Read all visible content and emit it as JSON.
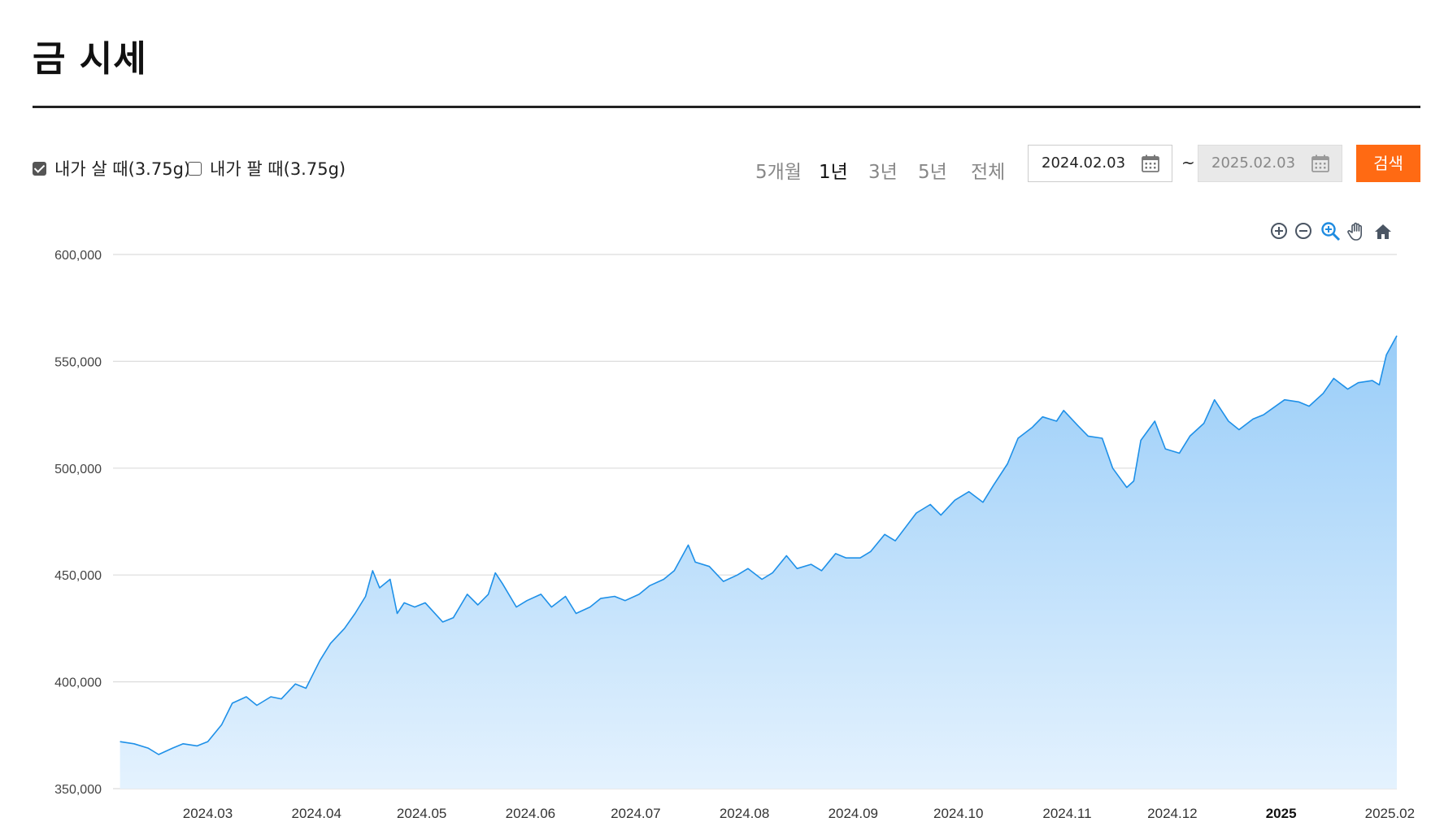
{
  "header": {
    "title": "금 시세"
  },
  "filters": {
    "buy": {
      "label": "내가 살 때(3.75g)",
      "checked": true
    },
    "sell": {
      "label": "내가 팔 때(3.75g)",
      "checked": false
    }
  },
  "periods": [
    "5개월",
    "1년",
    "3년",
    "5년",
    "전체"
  ],
  "active_period": "1년",
  "date_range": {
    "start": "2024.02.03",
    "end": "2025.02.03",
    "separator": "~"
  },
  "search_label": "검색",
  "toolbar": [
    "zoom-in-icon",
    "zoom-out-icon",
    "zoom-select-icon",
    "pan-hand-icon",
    "home-reset-icon"
  ],
  "colors": {
    "accent": "#ff6a13",
    "line": "#1e90e8",
    "area_top": "#9fd0f8",
    "area_bottom": "#e3f1fd"
  },
  "chart_data": {
    "type": "area",
    "ylim": [
      350000,
      600000
    ],
    "yticks": [
      "600,000",
      "550,000",
      "500,000",
      "450,000",
      "400,000",
      "350,000"
    ],
    "ytick_values": [
      600000,
      550000,
      500000,
      450000,
      400000,
      350000
    ],
    "xticks": [
      {
        "label": "2024.03",
        "date": "2024-03-01"
      },
      {
        "label": "2024.04",
        "date": "2024-04-01"
      },
      {
        "label": "2024.05",
        "date": "2024-05-01"
      },
      {
        "label": "2024.06",
        "date": "2024-06-01"
      },
      {
        "label": "2024.07",
        "date": "2024-07-01"
      },
      {
        "label": "2024.08",
        "date": "2024-08-01"
      },
      {
        "label": "2024.09",
        "date": "2024-09-01"
      },
      {
        "label": "2024.10",
        "date": "2024-10-01"
      },
      {
        "label": "2024.11",
        "date": "2024-11-01"
      },
      {
        "label": "2024.12",
        "date": "2024-12-01"
      },
      {
        "label": "2025",
        "date": "2025-01-01",
        "bold": true
      },
      {
        "label": "2025.02",
        "date": "2025-02-01"
      }
    ],
    "x": [
      "2024-02-05",
      "2024-02-09",
      "2024-02-13",
      "2024-02-16",
      "2024-02-20",
      "2024-02-23",
      "2024-02-27",
      "2024-03-01",
      "2024-03-05",
      "2024-03-08",
      "2024-03-12",
      "2024-03-15",
      "2024-03-19",
      "2024-03-22",
      "2024-03-26",
      "2024-03-29",
      "2024-04-02",
      "2024-04-05",
      "2024-04-09",
      "2024-04-12",
      "2024-04-15",
      "2024-04-17",
      "2024-04-19",
      "2024-04-22",
      "2024-04-24",
      "2024-04-26",
      "2024-04-29",
      "2024-05-02",
      "2024-05-07",
      "2024-05-10",
      "2024-05-14",
      "2024-05-17",
      "2024-05-20",
      "2024-05-22",
      "2024-05-24",
      "2024-05-28",
      "2024-05-31",
      "2024-06-04",
      "2024-06-07",
      "2024-06-11",
      "2024-06-14",
      "2024-06-18",
      "2024-06-21",
      "2024-06-25",
      "2024-06-28",
      "2024-07-02",
      "2024-07-05",
      "2024-07-09",
      "2024-07-12",
      "2024-07-16",
      "2024-07-18",
      "2024-07-22",
      "2024-07-26",
      "2024-07-30",
      "2024-08-02",
      "2024-08-06",
      "2024-08-09",
      "2024-08-13",
      "2024-08-16",
      "2024-08-20",
      "2024-08-23",
      "2024-08-27",
      "2024-08-30",
      "2024-09-03",
      "2024-09-06",
      "2024-09-10",
      "2024-09-13",
      "2024-09-19",
      "2024-09-23",
      "2024-09-26",
      "2024-09-30",
      "2024-10-04",
      "2024-10-08",
      "2024-10-11",
      "2024-10-15",
      "2024-10-18",
      "2024-10-22",
      "2024-10-25",
      "2024-10-29",
      "2024-10-31",
      "2024-11-04",
      "2024-11-07",
      "2024-11-11",
      "2024-11-14",
      "2024-11-18",
      "2024-11-20",
      "2024-11-22",
      "2024-11-26",
      "2024-11-29",
      "2024-12-03",
      "2024-12-06",
      "2024-12-10",
      "2024-12-13",
      "2024-12-17",
      "2024-12-20",
      "2024-12-24",
      "2024-12-27",
      "2025-01-02",
      "2025-01-06",
      "2025-01-09",
      "2025-01-13",
      "2025-01-16",
      "2025-01-20",
      "2025-01-23",
      "2025-01-27",
      "2025-01-29",
      "2025-01-31",
      "2025-02-03"
    ],
    "values": [
      372000,
      371000,
      369000,
      366000,
      369000,
      371000,
      370000,
      372000,
      380000,
      390000,
      393000,
      389000,
      393000,
      392000,
      399000,
      397000,
      410000,
      418000,
      425000,
      432000,
      440000,
      452000,
      444000,
      448000,
      432000,
      437000,
      435000,
      437000,
      428000,
      430000,
      441000,
      436000,
      441000,
      451000,
      446000,
      435000,
      438000,
      441000,
      435000,
      440000,
      432000,
      435000,
      439000,
      440000,
      438000,
      441000,
      445000,
      448000,
      452000,
      464000,
      456000,
      454000,
      447000,
      450000,
      453000,
      448000,
      451000,
      459000,
      453000,
      455000,
      452000,
      460000,
      458000,
      458000,
      461000,
      469000,
      466000,
      479000,
      483000,
      478000,
      485000,
      489000,
      484000,
      492000,
      502000,
      514000,
      519000,
      524000,
      522000,
      527000,
      520000,
      515000,
      514000,
      500000,
      491000,
      494000,
      513000,
      522000,
      509000,
      507000,
      515000,
      521000,
      532000,
      522000,
      518000,
      523000,
      525000,
      532000,
      531000,
      529000,
      535000,
      542000,
      537000,
      540000,
      541000,
      539000,
      553000,
      562000
    ],
    "xlabel": "",
    "ylabel": "",
    "grid": true
  }
}
